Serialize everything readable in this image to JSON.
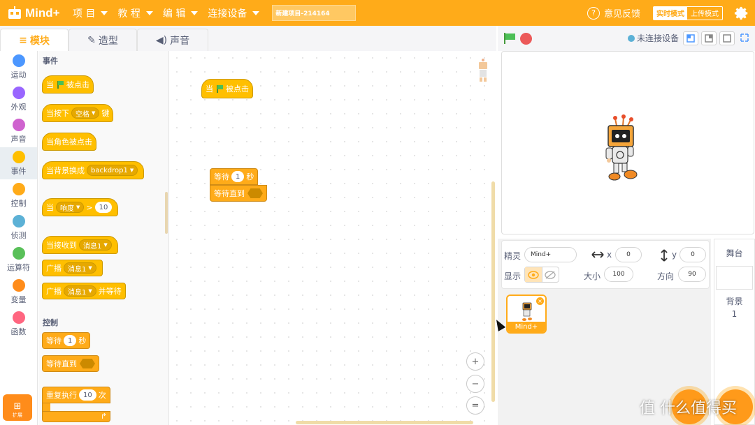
{
  "app": {
    "logo_text": "Mind+",
    "project_name": "新建项目-214164"
  },
  "menu": [
    {
      "label": "项 目"
    },
    {
      "label": "教 程"
    },
    {
      "label": "编 辑"
    },
    {
      "label": "连接设备"
    }
  ],
  "topbar": {
    "feedback": "意见反馈",
    "mode_realtime": "实时模式",
    "mode_upload": "上传模式"
  },
  "tabs": [
    {
      "label": "模块",
      "icon": "blocks-icon"
    },
    {
      "label": "造型",
      "icon": "brush-icon"
    },
    {
      "label": "声音",
      "icon": "speaker-icon"
    }
  ],
  "categories": [
    {
      "label": "运动",
      "color": "#4c97ff"
    },
    {
      "label": "外观",
      "color": "#9966ff"
    },
    {
      "label": "声音",
      "color": "#cf63cf"
    },
    {
      "label": "事件",
      "color": "#ffbf00"
    },
    {
      "label": "控制",
      "color": "#ffab19"
    },
    {
      "label": "侦测",
      "color": "#5cb1d6"
    },
    {
      "label": "运算符",
      "color": "#59c059"
    },
    {
      "label": "变量",
      "color": "#ff8c1a"
    },
    {
      "label": "函数",
      "color": "#ff6680"
    }
  ],
  "extension_label": "扩展",
  "palette": {
    "events_title": "事件",
    "control_title": "控制",
    "b_flag_when": "当",
    "b_flag_clicked": "被点击",
    "b_key_when": "当按下",
    "b_key_value": "空格",
    "b_key_suffix": "键",
    "b_sprite_clicked": "当角色被点击",
    "b_backdrop": "当背景换成",
    "b_backdrop_value": "backdrop1",
    "b_loud_when": "当",
    "b_loud_value": "响度",
    "b_loud_op": ">",
    "b_loud_num": "10",
    "b_recv": "当接收到",
    "b_recv_value": "消息1",
    "b_broadcast": "广播",
    "b_broadcast_value": "消息1",
    "b_broadcast_wait": "广播",
    "b_broadcast_wait_value": "消息1",
    "b_broadcast_wait_suffix": "并等待",
    "b_wait": "等待",
    "b_wait_num": "1",
    "b_wait_unit": "秒",
    "b_wait_until": "等待直到",
    "b_repeat": "重复执行",
    "b_repeat_num": "10",
    "b_repeat_unit": "次"
  },
  "canvas": {
    "s1_when": "当",
    "s1_clicked": "被点击",
    "s2_wait": "等待",
    "s2_num": "1",
    "s2_unit": "秒",
    "s2_until": "等待直到",
    "zoom_in": "+",
    "zoom_out": "−",
    "zoom_reset": "="
  },
  "stage_bar": {
    "connection": "未连接设备"
  },
  "sprite_info": {
    "sprite_label": "精灵",
    "sprite_name": "Mind+",
    "x_label": "x",
    "x_value": "0",
    "y_label": "y",
    "y_value": "0",
    "show_label": "显示",
    "size_label": "大小",
    "size_value": "100",
    "dir_label": "方向",
    "dir_value": "90"
  },
  "sprites": [
    {
      "name": "Mind+"
    }
  ],
  "stage_col": {
    "title": "舞台",
    "backdrop_label": "背景",
    "backdrop_count": "1"
  },
  "watermark": "值 什么值得买"
}
